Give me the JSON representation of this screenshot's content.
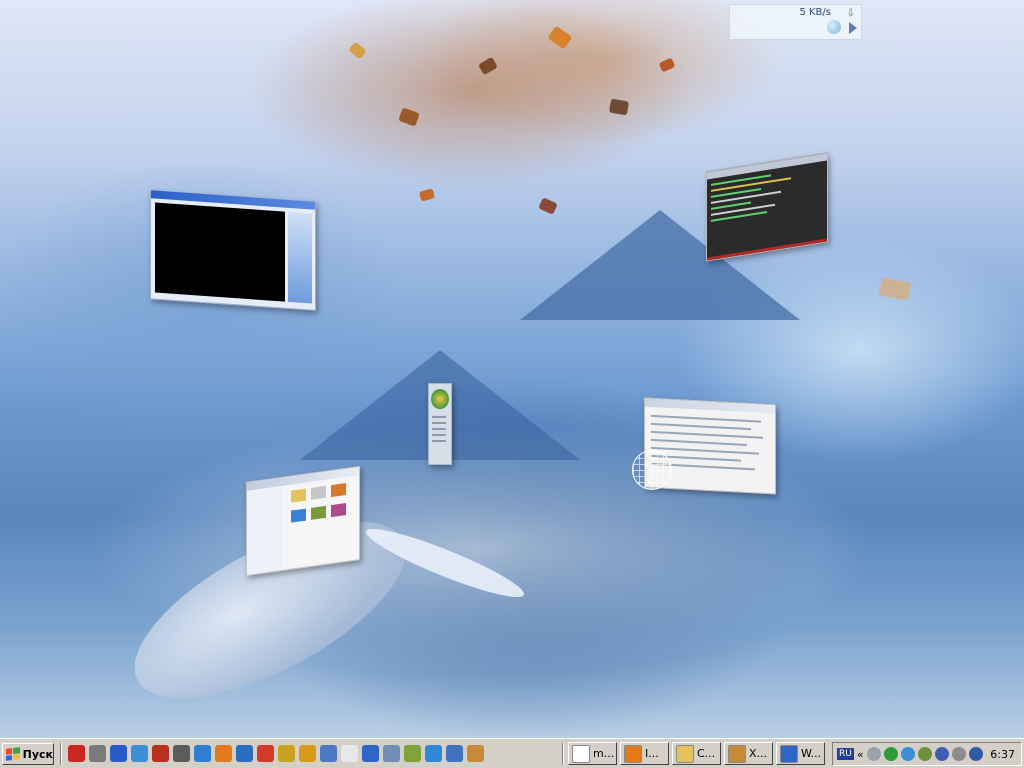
{
  "desktop": {
    "net_meter": {
      "speed": "5 KB/s"
    }
  },
  "windows": [
    {
      "name": "media-player-window"
    },
    {
      "name": "terminal-window"
    },
    {
      "name": "plant-app-window"
    },
    {
      "name": "browser-window"
    },
    {
      "name": "file-explorer-window"
    }
  ],
  "taskbar": {
    "start_label": "Пуск",
    "quick_launch": [
      {
        "icon": "acrobat-icon",
        "color": "#c7281f"
      },
      {
        "icon": "tools-icon",
        "color": "#7a7a7a"
      },
      {
        "icon": "network-icon",
        "color": "#2a5cc9"
      },
      {
        "icon": "globe-icon",
        "color": "#3a8fd6"
      },
      {
        "icon": "filezilla-icon",
        "color": "#b8301f"
      },
      {
        "icon": "text-tool-icon",
        "color": "#5c5c5c"
      },
      {
        "icon": "azureus-icon",
        "color": "#2e7fd0"
      },
      {
        "icon": "firefox-icon",
        "color": "#e27a1c"
      },
      {
        "icon": "browser2-icon",
        "color": "#2b6dc0"
      },
      {
        "icon": "opera-icon",
        "color": "#d23a2a"
      },
      {
        "icon": "puzzle-icon",
        "color": "#c9a21e"
      },
      {
        "icon": "magnifier-icon",
        "color": "#d99a1c"
      },
      {
        "icon": "window-icon",
        "color": "#4a78c2"
      },
      {
        "icon": "info-icon",
        "color": "#e8e8e8"
      },
      {
        "icon": "media-icon",
        "color": "#2f66c6"
      },
      {
        "icon": "recycle-icon",
        "color": "#6f8fb6"
      },
      {
        "icon": "settings-icon",
        "color": "#7fa23a"
      },
      {
        "icon": "ie-icon",
        "color": "#2f87d6"
      },
      {
        "icon": "outlook-icon",
        "color": "#3f72bf"
      },
      {
        "icon": "gimp-icon",
        "color": "#c78a3b"
      }
    ],
    "tasks": [
      {
        "icon": "info-icon",
        "color": "#ffffff",
        "label": "m..."
      },
      {
        "icon": "firefox-icon",
        "color": "#e27a1c",
        "label": "I..."
      },
      {
        "icon": "folder-icon",
        "color": "#e6c25a",
        "label": "C..."
      },
      {
        "icon": "gimp-icon",
        "color": "#c78a3b",
        "label": "X..."
      },
      {
        "icon": "media-icon",
        "color": "#2f66c6",
        "label": "W..."
      }
    ],
    "tray": {
      "language": "RU",
      "expand": "«",
      "icons": [
        {
          "icon": "disk-icon",
          "color": "#9aa3ad"
        },
        {
          "icon": "clover-icon",
          "color": "#2e9b3b"
        },
        {
          "icon": "globe-tray-icon",
          "color": "#3a8fd6"
        },
        {
          "icon": "network-tray-icon",
          "color": "#6f8f3a"
        },
        {
          "icon": "monitor-icon",
          "color": "#3f5fb0"
        },
        {
          "icon": "speaker-icon",
          "color": "#8c8c8c"
        },
        {
          "icon": "help-icon",
          "color": "#2f5aa8"
        }
      ],
      "clock": "6:37"
    }
  }
}
